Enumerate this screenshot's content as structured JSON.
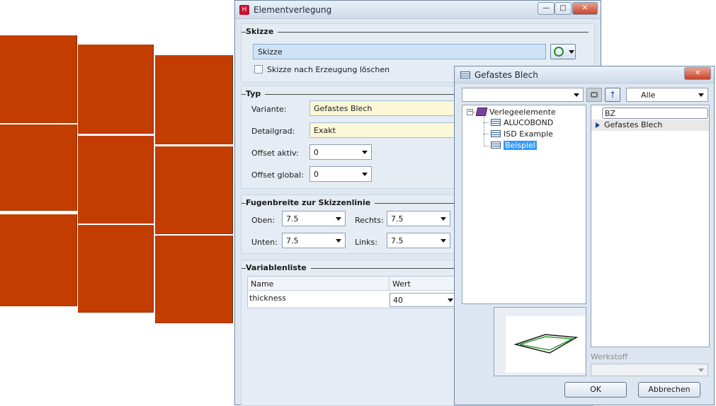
{
  "main_window": {
    "title": "Elementverlegung",
    "skizze": {
      "header": "Skizze",
      "field_value": "Skizze",
      "checkbox_label": "Skizze nach Erzeugung löschen"
    },
    "typ": {
      "header": "Typ",
      "variante_label": "Variante:",
      "variante_value": "Gefastes Blech",
      "detailgrad_label": "Detailgrad:",
      "detailgrad_value": "Exakt",
      "offset_aktiv_label": "Offset aktiv:",
      "offset_aktiv_value": "0",
      "offset_global_label": "Offset global:",
      "offset_global_value": "0"
    },
    "fugen": {
      "header": "Fugenbreite zur Skizzenlinie",
      "oben_label": "Oben:",
      "oben_value": "7.5",
      "rechts_label": "Rechts:",
      "rechts_value": "7.5",
      "unten_label": "Unten:",
      "unten_value": "7.5",
      "links_label": "Links:",
      "links_value": "7.5"
    },
    "variablen": {
      "header": "Variablenliste",
      "col_name": "Name",
      "col_wert": "Wert",
      "rows": [
        {
          "name": "thickness",
          "wert": "40"
        }
      ]
    },
    "window_buttons": {
      "minimize": "—",
      "maximize": "□",
      "close": "✕"
    }
  },
  "sub_window": {
    "title": "Gefastes Blech",
    "filter_value": "Alle",
    "tree": {
      "root": "Verlegeelemente",
      "items": [
        "ALUCOBOND",
        "ISD Example",
        "Beispiel"
      ],
      "selected": "Beispiel"
    },
    "list": {
      "column_header": "BZ",
      "items": [
        "Gefastes Blech"
      ]
    },
    "werkstoff_label": "Werkstoff",
    "ok_label": "OK",
    "cancel_label": "Abbrechen",
    "close_glyph": "✕"
  },
  "colors": {
    "tile_fill": "#c43d00",
    "input_yellow": "#fbf8d8",
    "selection_blue": "#3399ff"
  }
}
